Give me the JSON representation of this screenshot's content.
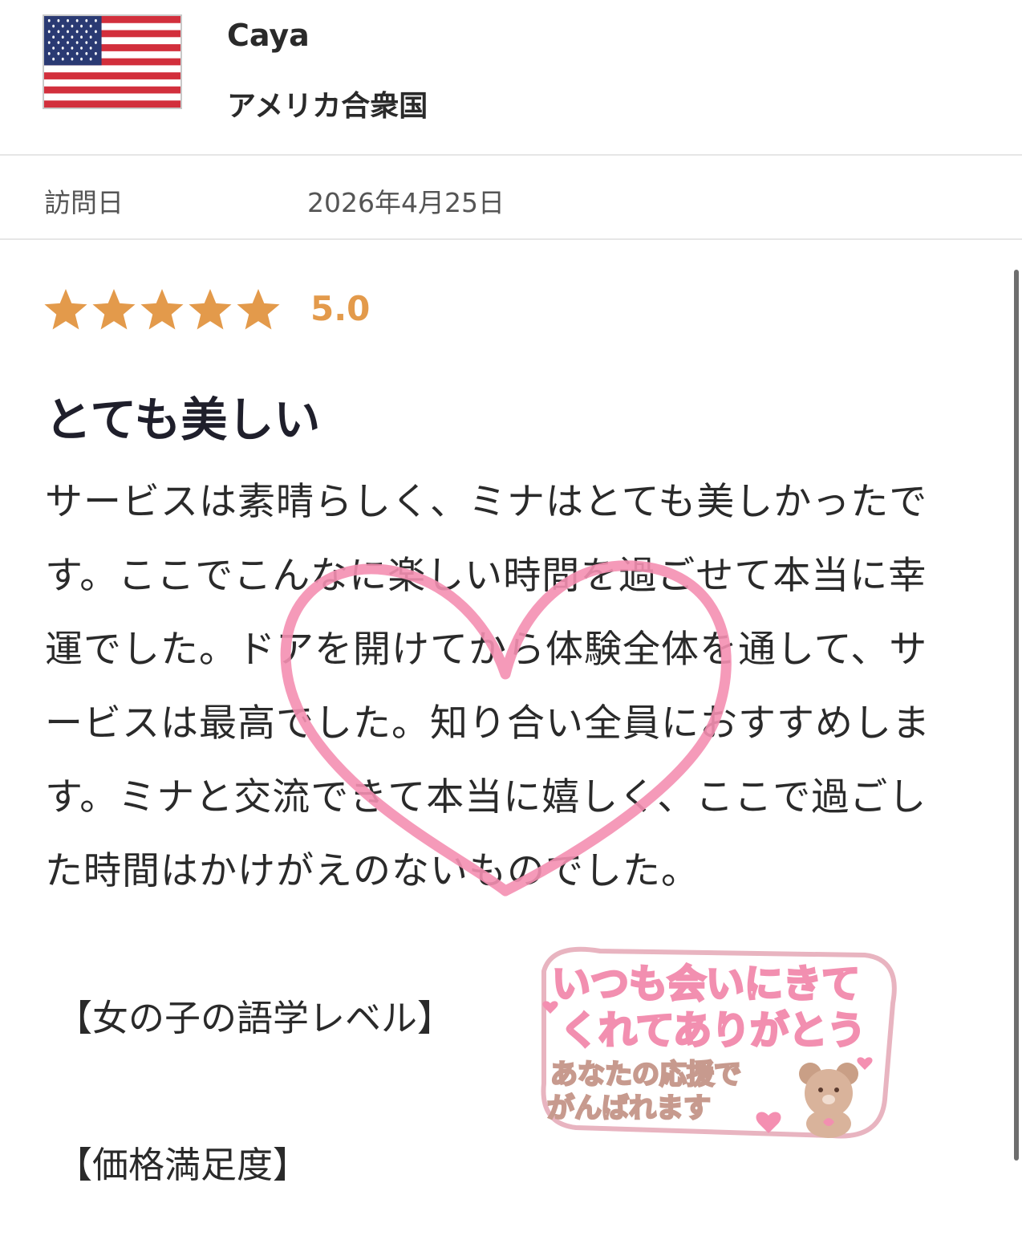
{
  "reviewer": {
    "name": "Caya",
    "country": "アメリカ合衆国",
    "flag_icon": "us-flag-icon"
  },
  "visit": {
    "label": "訪問日",
    "date": "2026年4月25日"
  },
  "rating": {
    "stars": 5,
    "max_stars": 5,
    "score": "5.0",
    "star_color": "#e39a4b"
  },
  "review": {
    "title": "とても美しい",
    "lines": [
      "サービスは素晴らしく、ミナはとても美しかったで",
      "す。ここでこんなに楽しい時間を過ごせて本当に幸",
      "運でした。ドアを開けてから体験全体を通して、サ",
      "ービスは最高でした。知り合い全員におすすめしま",
      "す。ミナと交流できて本当に嬉しく、ここで過ごし",
      "た時間はかけがえのないものでした。"
    ]
  },
  "sections": {
    "language_level": "【女の子の語学レベル】",
    "price_satisfaction": "【価格満足度】"
  },
  "sticker": {
    "line1": "いつも会いにきて",
    "line2": "くれてありがとう",
    "line3": "あなたの応援で",
    "line4": "がんばれます",
    "accent_color": "#f4a8c0"
  },
  "colors": {
    "heart": "#f48fb1",
    "divider": "#e6e6e6"
  }
}
